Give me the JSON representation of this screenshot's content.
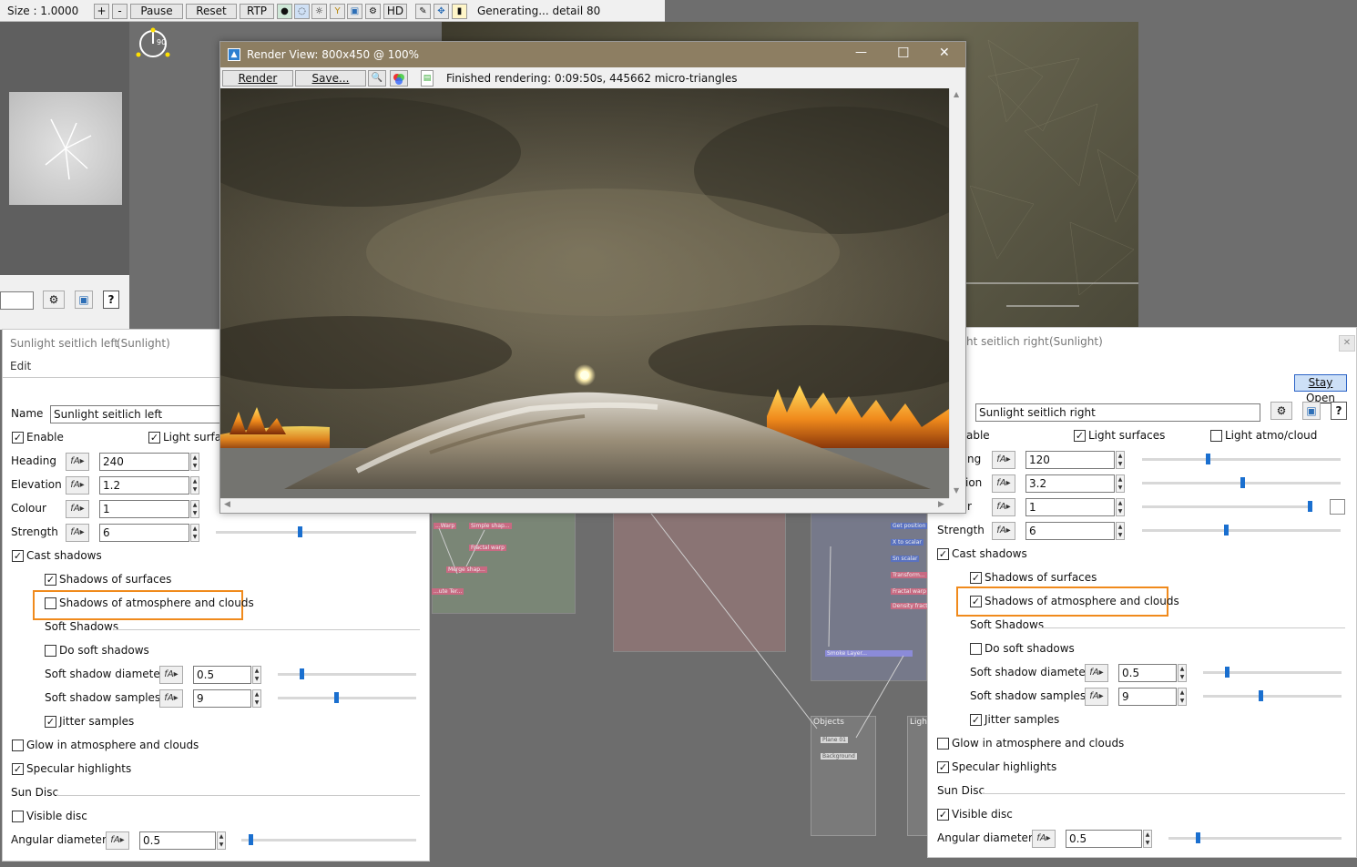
{
  "toolbar": {
    "size_label": "Size : 1.0000",
    "plus": "+",
    "minus": "-",
    "pause": "Pause",
    "reset": "Reset",
    "rtp": "RTP",
    "hd": "HD",
    "status": "Generating... detail 80"
  },
  "compass": {
    "value": "90"
  },
  "render_view": {
    "title": "Render View: 800x450 @ 100%",
    "render_btn": "Render",
    "save_btn": "Save...",
    "status": "Finished rendering:  0:09:50s, 445662 micro-triangles",
    "minimize": "—",
    "maximize": "☐",
    "close": "✕"
  },
  "left_panel": {
    "title": "Sunlight seitlich left",
    "type": "(Sunlight)",
    "edit": "Edit",
    "name_label": "Name",
    "name_value": "Sunlight seitlich left",
    "enable": "Enable",
    "light_surfaces": "Light surfac",
    "heading_label": "Heading",
    "heading_value": "240",
    "elevation_label": "Elevation",
    "elevation_value": "1.2",
    "colour_label": "Colour",
    "colour_value": "1",
    "strength_label": "Strength",
    "strength_value": "6",
    "strength_level": 0.42,
    "cast_shadows": "Cast shadows",
    "shadows_surfaces": "Shadows of surfaces",
    "shadows_atmo": "Shadows of atmosphere and clouds",
    "soft_shadows_header": "Soft Shadows",
    "do_soft": "Do soft shadows",
    "soft_diam_label": "Soft shadow diameter",
    "soft_diam_value": "0.5",
    "soft_diam_level": 0.17,
    "soft_samp_label": "Soft shadow samples",
    "soft_samp_value": "9",
    "soft_samp_level": 0.42,
    "jitter": "Jitter samples",
    "glow": "Glow in atmosphere and clouds",
    "specular": "Specular highlights",
    "sun_disc_header": "Sun Disc",
    "visible_disc": "Visible disc",
    "angular_label": "Angular diameter",
    "angular_value": "0.5",
    "angular_level": 0.05
  },
  "right_panel": {
    "title": "ht seitlich right",
    "type": "(Sunlight)",
    "stay_open": "Stay Open",
    "name_value": "Sunlight seitlich right",
    "enable": "able",
    "light_surfaces": "Light surfaces",
    "light_atmo": "Light atmo/cloud",
    "heading_label": "ng",
    "heading_value": "120",
    "elevation_label": "ion",
    "elevation_value": "3.2",
    "colour_label": "r",
    "colour_value": "1",
    "strength_label": "Strength",
    "strength_value": "6",
    "cast_shadows": "Cast shadows",
    "shadows_surfaces": "Shadows of surfaces",
    "shadows_atmo": "Shadows of atmosphere and clouds",
    "soft_shadows_header": "Soft Shadows",
    "do_soft": "Do soft shadows",
    "soft_diam_label": "Soft shadow diameter",
    "soft_diam_value": "0.5",
    "soft_samp_label": "Soft shadow samples",
    "soft_samp_value": "9",
    "jitter": "Jitter samples",
    "glow": "Glow in atmosphere and clouds",
    "specular": "Specular highlights",
    "sun_disc_header": "Sun Disc",
    "visible_disc": "Visible disc",
    "angular_label": "Angular diameter",
    "angular_value": "0.5"
  },
  "node_graph": {
    "groups": [
      "Objects",
      "Light"
    ],
    "pink_nodes": [
      "...Warp",
      "Simple shap...",
      "Fractal warp",
      "Merge shap...",
      "...ute Ter..."
    ],
    "blue_nodes": [
      "Get position",
      "X to scalar",
      "Sn scalar",
      "Transform...",
      "Fractal warp",
      "Density fract..."
    ],
    "smoke": "Smoke Layer...",
    "objects_nodes": [
      "Plane 01",
      "Background"
    ]
  },
  "colors": {
    "highlight": "#f08a1c",
    "slider_thumb": "#1a6fcf"
  }
}
